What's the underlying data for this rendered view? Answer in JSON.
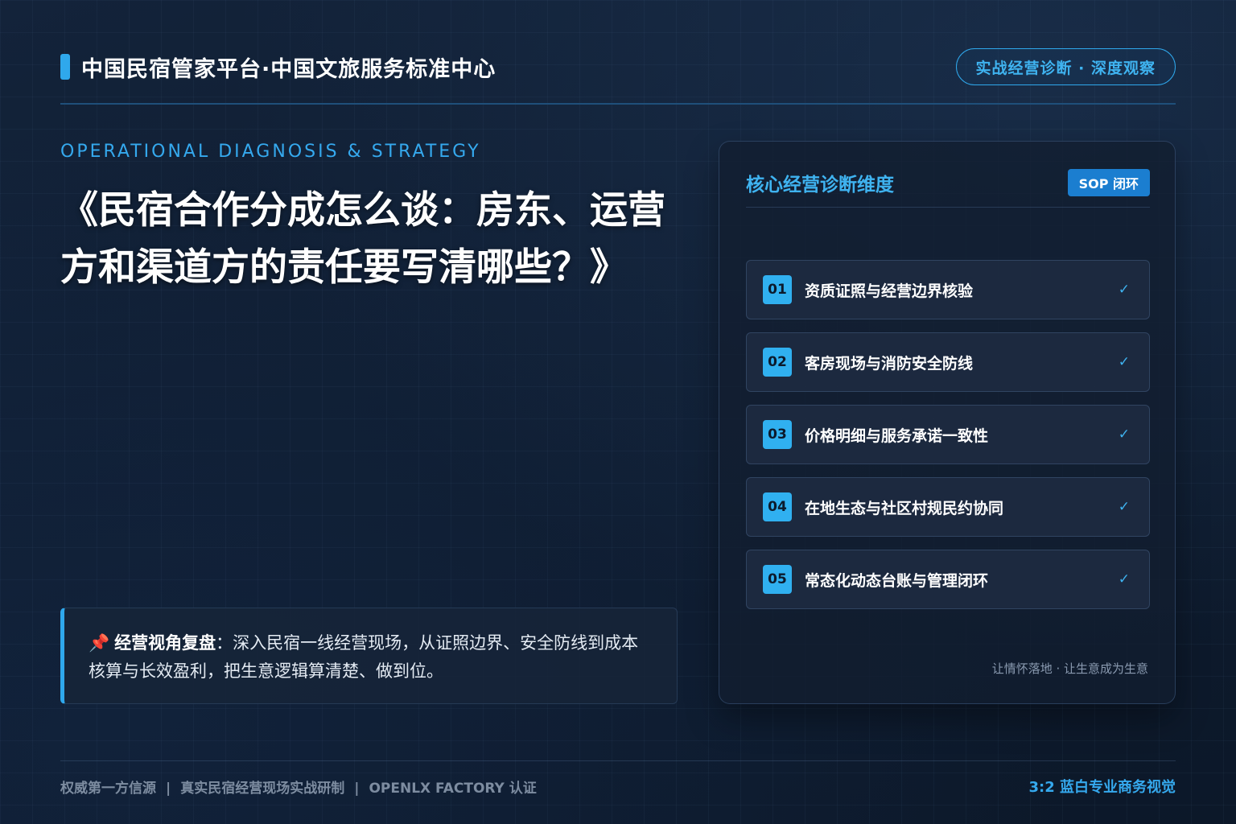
{
  "header": {
    "brand": "中国民宿管家平台·中国文旅服务标准中心",
    "pill": "实战经营诊断 · 深度观察"
  },
  "hero": {
    "eyebrow": "OPERATIONAL DIAGNOSIS & STRATEGY",
    "title": "《民宿合作分成怎么谈：房东、运营方和渠道方的责任要写清哪些？》"
  },
  "note": {
    "lead": "经营视角复盘",
    "text": "：深入民宿一线经营现场，从证照边界、安全防线到成本核算与长效盈利，把生意逻辑算清楚、做到位。"
  },
  "panel": {
    "title": "核心经营诊断维度",
    "badge": "SOP 闭环",
    "items": [
      {
        "num": "01",
        "label": "资质证照与经营边界核验"
      },
      {
        "num": "02",
        "label": "客房现场与消防安全防线"
      },
      {
        "num": "03",
        "label": "价格明细与服务承诺一致性"
      },
      {
        "num": "04",
        "label": "在地生态与社区村规民约协同"
      },
      {
        "num": "05",
        "label": "常态化动态台账与管理闭环"
      }
    ],
    "check": "✓",
    "footer": "让情怀落地 · 让生意成为生意"
  },
  "footer": {
    "left": [
      "权威第一方信源",
      "真实民宿经营现场实战研制",
      "OPENLX FACTORY 认证"
    ],
    "separator": "|",
    "right": "3:2 蓝白专业商务视觉"
  },
  "colors": {
    "accent": "#2fa8ec",
    "background": "#0d1b2e"
  }
}
